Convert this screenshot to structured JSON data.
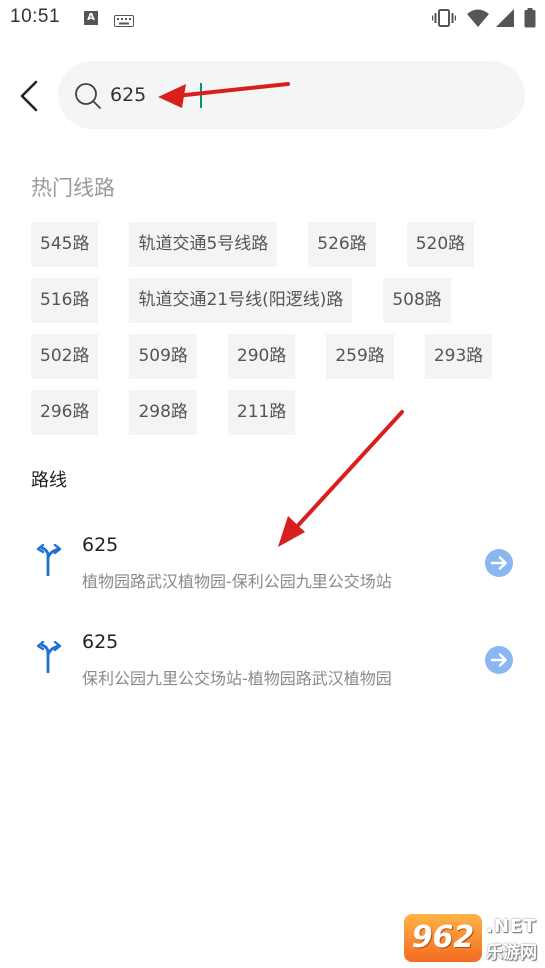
{
  "status_bar": {
    "time": "10:51",
    "app_badge": "A",
    "icons": [
      "text-a-icon",
      "keyboard-icon",
      "vibrate-icon",
      "wifi-icon",
      "signal-icon",
      "battery-icon"
    ]
  },
  "header": {
    "back_icon": "chevron-left-icon",
    "search_icon": "search-icon",
    "search_value": "625"
  },
  "hot_lines": {
    "title": "热门线路",
    "rows": [
      [
        "545路",
        "轨道交通5号线路",
        "526路",
        "520路"
      ],
      [
        "516路",
        "轨道交通21号线(阳逻线)路",
        "508路"
      ],
      [
        "502路",
        "509路",
        "290路",
        "259路",
        "293路"
      ],
      [
        "296路",
        "298路",
        "211路"
      ]
    ]
  },
  "routes": {
    "title": "路线",
    "items": [
      {
        "number": "625",
        "desc": "植物园路武汉植物园-保利公园九里公交场站"
      },
      {
        "number": "625",
        "desc": "保利公园九里公交场站-植物园路武汉植物园"
      }
    ]
  },
  "colors": {
    "route_icon": "#1e6fd6",
    "go_button": "#8ab6f2",
    "annotation_arrow": "#d91e1e",
    "hot_tag_bg": "#f4f4f4",
    "search_bg": "#f5f5f5"
  },
  "watermark": {
    "logo": "962",
    "net": ".NET",
    "cn": "乐游网"
  }
}
